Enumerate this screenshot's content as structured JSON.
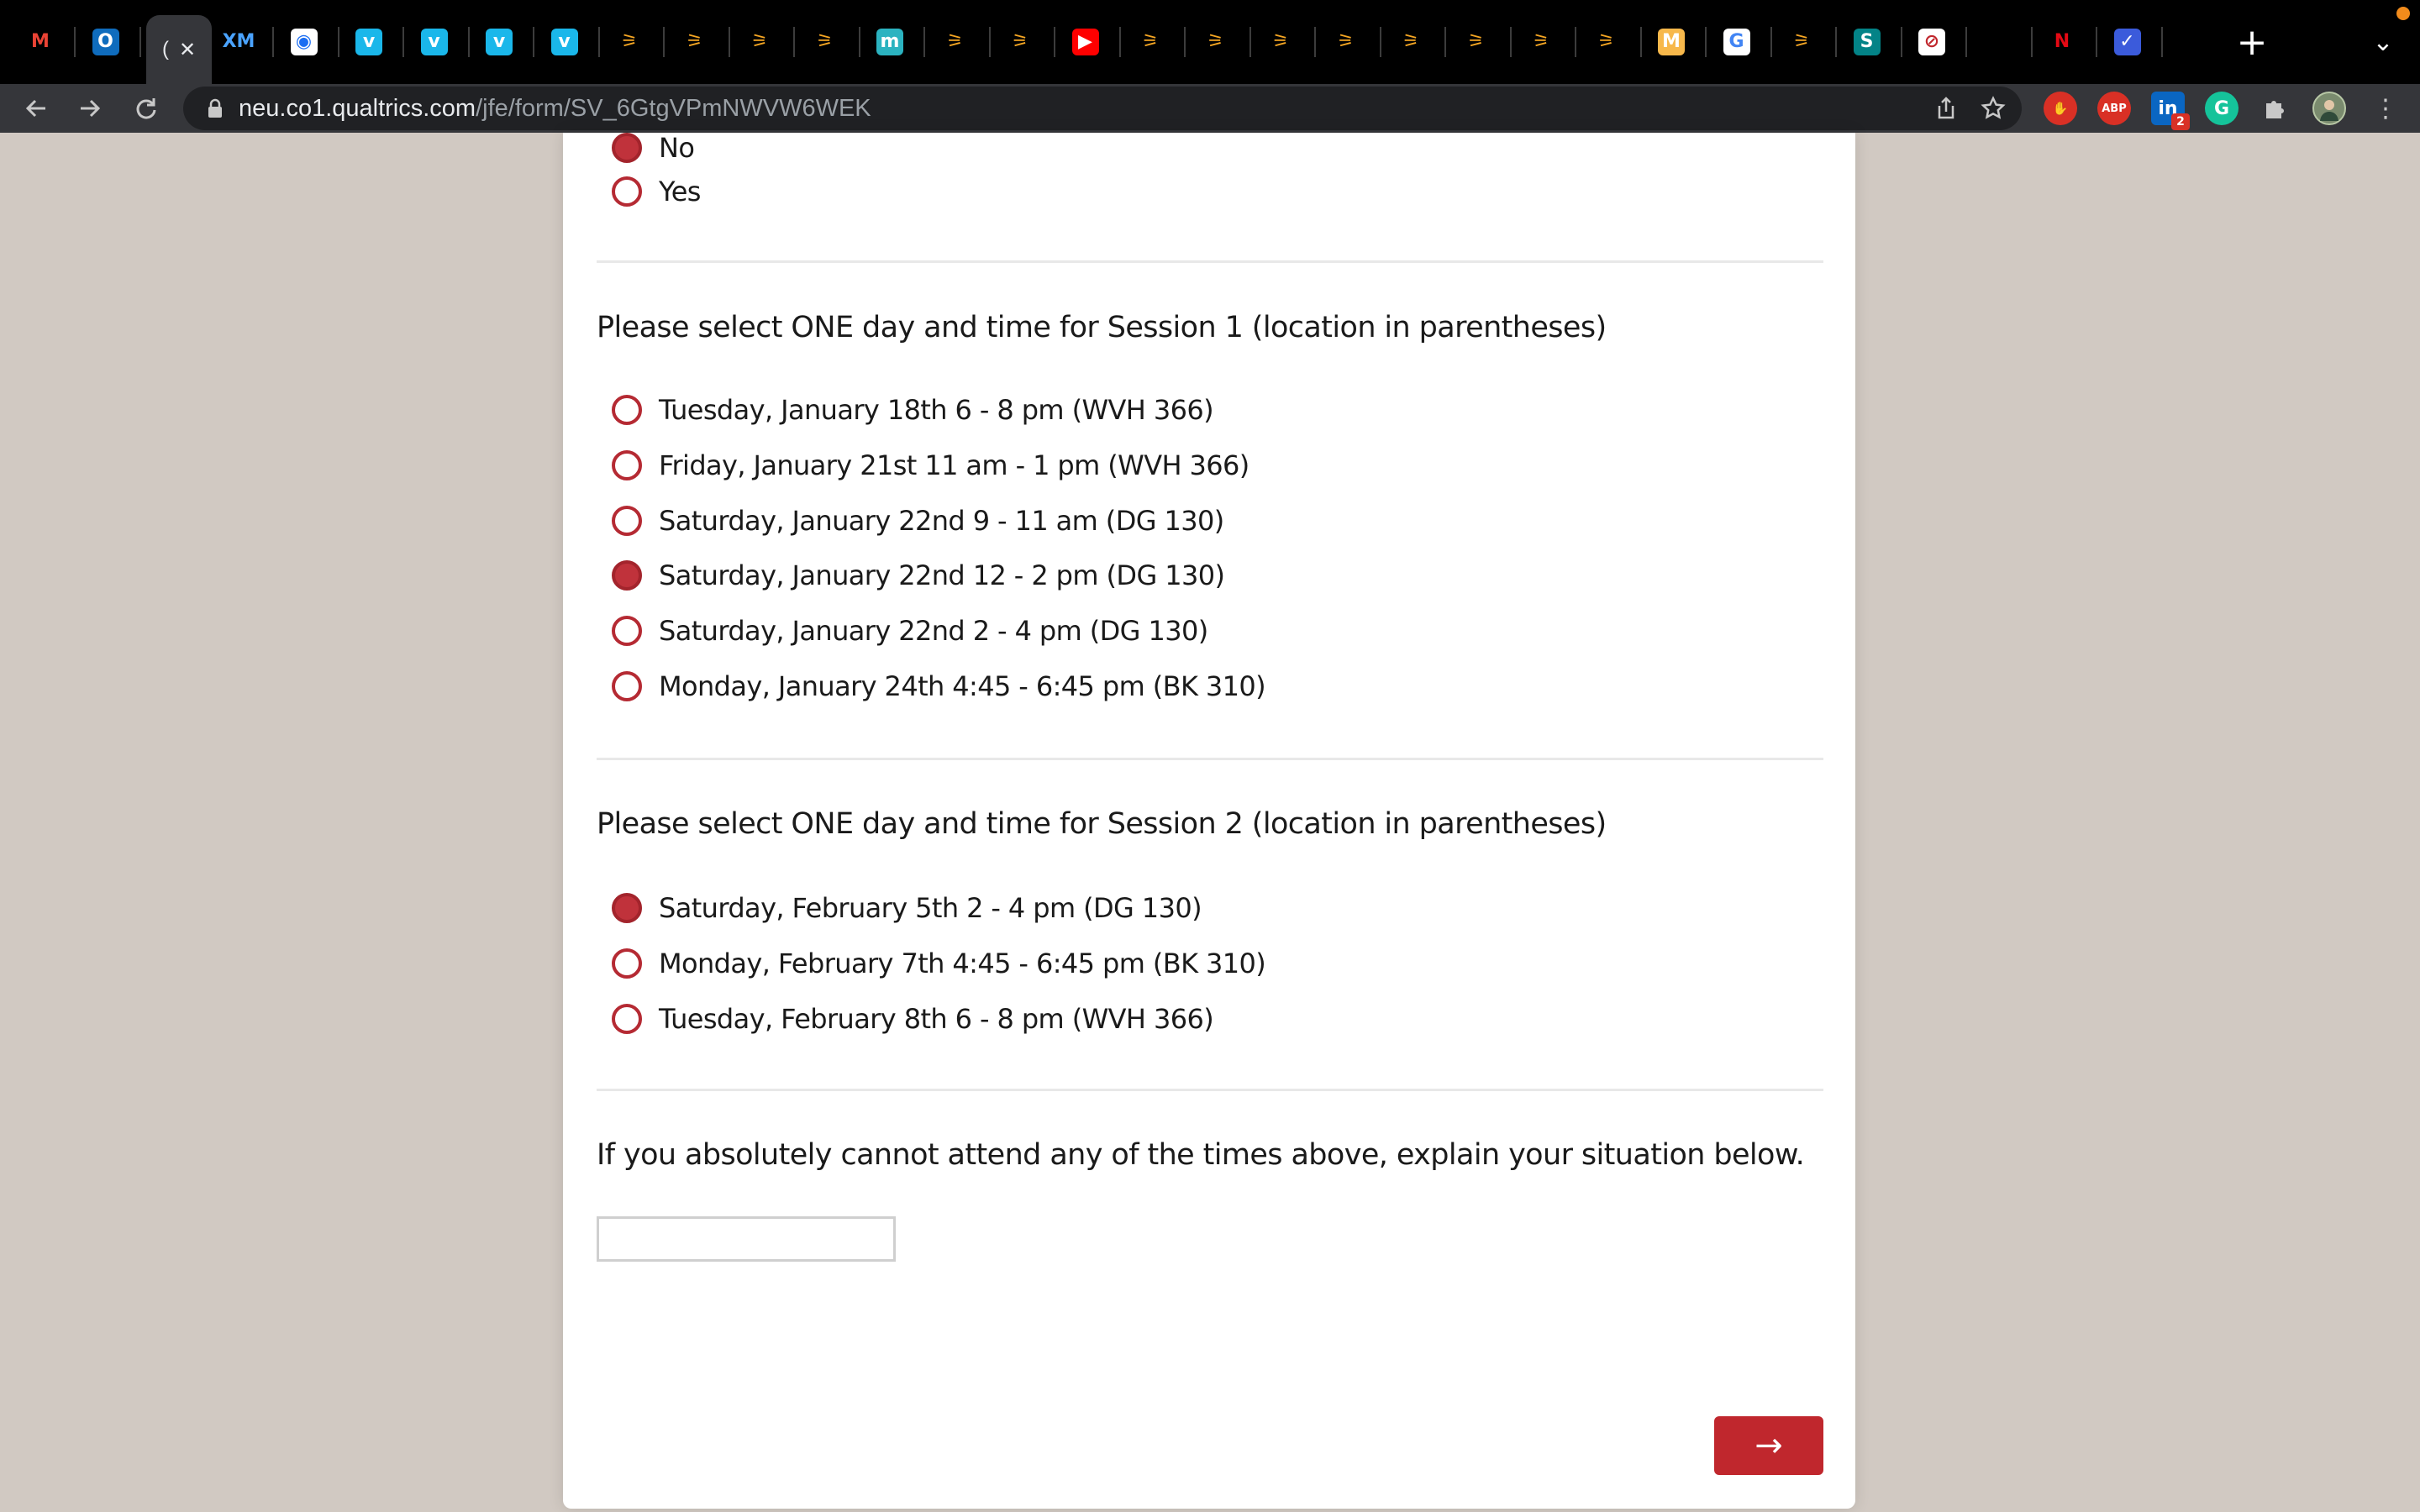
{
  "browser": {
    "tabs": [
      {
        "name": "gmail-tab",
        "glyph": "M",
        "color": "#ea4335",
        "bg": "transparent"
      },
      {
        "name": "outlook-tab",
        "glyph": "O",
        "color": "#ffffff",
        "bg": "#0f6cbd"
      },
      {
        "name": "xm-tab",
        "glyph": "XM",
        "color": "#4aa3ff",
        "bg": "transparent"
      },
      {
        "name": "app-tab",
        "glyph": "◉",
        "color": "#1c6ef2",
        "bg": "#ffffff"
      },
      {
        "name": "vimeo-tab-1",
        "glyph": "v",
        "color": "#ffffff",
        "bg": "#1ab7ea"
      },
      {
        "name": "vimeo-tab-2",
        "glyph": "v",
        "color": "#ffffff",
        "bg": "#1ab7ea"
      },
      {
        "name": "vimeo-tab-3",
        "glyph": "v",
        "color": "#ffffff",
        "bg": "#1ab7ea"
      },
      {
        "name": "vimeo-tab-4",
        "glyph": "v",
        "color": "#ffffff",
        "bg": "#1ab7ea"
      },
      {
        "name": "app-tab-a1",
        "glyph": "⚞",
        "color": "#f5a623",
        "bg": "transparent"
      },
      {
        "name": "app-tab-a2",
        "glyph": "⚞",
        "color": "#f5a623",
        "bg": "transparent"
      },
      {
        "name": "app-tab-a3",
        "glyph": "⚞",
        "color": "#f5a623",
        "bg": "transparent"
      },
      {
        "name": "app-tab-a4",
        "glyph": "⚞",
        "color": "#f5a623",
        "bg": "transparent"
      },
      {
        "name": "m-tab",
        "glyph": "m",
        "color": "#ffffff",
        "bg": "#2bb3c0"
      },
      {
        "name": "app-tab-a5",
        "glyph": "⚞",
        "color": "#f5a623",
        "bg": "transparent"
      },
      {
        "name": "app-tab-a6",
        "glyph": "⚞",
        "color": "#f5a623",
        "bg": "transparent"
      },
      {
        "name": "youtube-tab",
        "glyph": "▶",
        "color": "#ffffff",
        "bg": "#ff0000"
      },
      {
        "name": "app-tab-a7",
        "glyph": "⚞",
        "color": "#f5a623",
        "bg": "transparent"
      },
      {
        "name": "app-tab-a8",
        "glyph": "⚞",
        "color": "#f5a623",
        "bg": "transparent"
      },
      {
        "name": "app-tab-a9",
        "glyph": "⚞",
        "color": "#f5a623",
        "bg": "transparent"
      },
      {
        "name": "app-tab-a10",
        "glyph": "⚞",
        "color": "#f5a623",
        "bg": "transparent"
      },
      {
        "name": "app-tab-a11",
        "glyph": "⚞",
        "color": "#f5a623",
        "bg": "transparent"
      },
      {
        "name": "app-tab-a12",
        "glyph": "⚞",
        "color": "#f5a623",
        "bg": "transparent"
      },
      {
        "name": "app-tab-a13",
        "glyph": "⚞",
        "color": "#f5a623",
        "bg": "transparent"
      },
      {
        "name": "app-tab-a14",
        "glyph": "⚞",
        "color": "#f5a623",
        "bg": "transparent"
      },
      {
        "name": "miro-tab",
        "glyph": "M",
        "color": "#ffffff",
        "bg": "#f7b84b"
      },
      {
        "name": "google-tab",
        "glyph": "G",
        "color": "#4285f4",
        "bg": "#ffffff"
      },
      {
        "name": "app-tab-a15",
        "glyph": "⚞",
        "color": "#f5a623",
        "bg": "transparent"
      },
      {
        "name": "sharepoint-tab",
        "glyph": "S",
        "color": "#ffffff",
        "bg": "#038387"
      },
      {
        "name": "blocked-tab",
        "glyph": "⊘",
        "color": "#c0272d",
        "bg": "#ffffff"
      },
      {
        "name": "blank-tab",
        "glyph": "",
        "color": "#ffffff",
        "bg": "transparent"
      },
      {
        "name": "netflix-tab",
        "glyph": "N",
        "color": "#e50914",
        "bg": "transparent"
      },
      {
        "name": "check-tab",
        "glyph": "✓",
        "color": "#ffffff",
        "bg": "#3b5bdb"
      }
    ],
    "active_tab_glyph": "(",
    "close_glyph": "✕",
    "new_tab_glyph": "+",
    "tab_search_glyph": "⌄",
    "url_host": "neu.co1.qualtrics.com",
    "url_path": "/jfe/form/SV_6GtgVPmNWVW6WEK",
    "extension_badge": "2",
    "extensions": {
      "abp_label": "ABP",
      "linkedin_label": "in",
      "grammarly_label": "G"
    }
  },
  "survey": {
    "prev_question": {
      "choices": [
        {
          "label": "No",
          "selected": true
        },
        {
          "label": "Yes",
          "selected": false
        }
      ]
    },
    "session1": {
      "question": "Please select ONE day and time for Session 1 (location in parentheses)",
      "choices": [
        {
          "label": "Tuesday, January 18th 6 - 8 pm (WVH 366)",
          "selected": false
        },
        {
          "label": "Friday, January 21st 11 am - 1 pm (WVH 366)",
          "selected": false
        },
        {
          "label": "Saturday, January 22nd 9 - 11 am (DG 130)",
          "selected": false
        },
        {
          "label": "Saturday, January 22nd 12 - 2 pm (DG 130)",
          "selected": true
        },
        {
          "label": "Saturday, January 22nd 2 - 4 pm (DG 130)",
          "selected": false
        },
        {
          "label": "Monday, January 24th 4:45 - 6:45 pm (BK 310)",
          "selected": false
        }
      ]
    },
    "session2": {
      "question": "Please select ONE day and time for Session 2 (location in parentheses)",
      "choices": [
        {
          "label": "Saturday, February 5th 2 - 4 pm (DG 130)",
          "selected": true
        },
        {
          "label": "Monday, February 7th 4:45 - 6:45 pm (BK 310)",
          "selected": false
        },
        {
          "label": "Tuesday, February 8th 6 - 8 pm (WVH 366)",
          "selected": false
        }
      ]
    },
    "explain": {
      "question": "If you absolutely cannot attend any of the times above, explain your situation below.",
      "value": "",
      "placeholder": ""
    },
    "next_label": "→"
  }
}
